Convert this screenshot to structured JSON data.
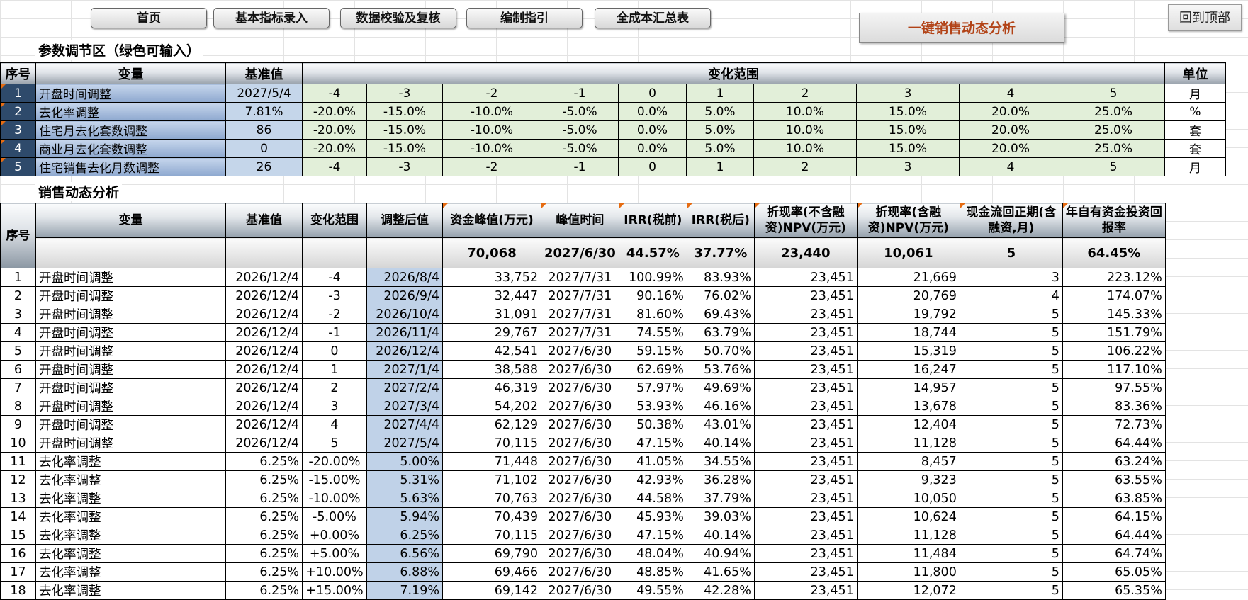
{
  "nav": {
    "buttons": [
      "首页",
      "基本指标录入",
      "数据校验及复核",
      "编制指引",
      "全成本汇总表"
    ],
    "analysis_button": "一键销售动态分析",
    "back_to_top": "回到顶部"
  },
  "param_section": {
    "title": "参数调节区（绿色可输入）",
    "headers": {
      "idx": "序号",
      "var": "变量",
      "base": "基准值",
      "range": "变化范围",
      "unit": "单位"
    },
    "rows": [
      {
        "idx": "1",
        "var": "开盘时间调整",
        "base": "2027/5/4",
        "range": [
          "-4",
          "-3",
          "-2",
          "-1",
          "0",
          "1",
          "2",
          "3",
          "4",
          "5"
        ],
        "unit": "月"
      },
      {
        "idx": "2",
        "var": "去化率调整",
        "base": "7.81%",
        "range": [
          "-20.0%",
          "-15.0%",
          "-10.0%",
          "-5.0%",
          "0.0%",
          "5.0%",
          "10.0%",
          "15.0%",
          "20.0%",
          "25.0%"
        ],
        "unit": "%"
      },
      {
        "idx": "3",
        "var": "住宅月去化套数调整",
        "base": "86",
        "range": [
          "-20.0%",
          "-15.0%",
          "-10.0%",
          "-5.0%",
          "0.0%",
          "5.0%",
          "10.0%",
          "15.0%",
          "20.0%",
          "25.0%"
        ],
        "unit": "套"
      },
      {
        "idx": "4",
        "var": "商业月去化套数调整",
        "base": "0",
        "range": [
          "-20.0%",
          "-15.0%",
          "-10.0%",
          "-5.0%",
          "0.0%",
          "5.0%",
          "10.0%",
          "15.0%",
          "20.0%",
          "25.0%"
        ],
        "unit": "套"
      },
      {
        "idx": "5",
        "var": "住宅销售去化月数调整",
        "base": "26",
        "range": [
          "-4",
          "-3",
          "-2",
          "-1",
          "0",
          "1",
          "2",
          "3",
          "4",
          "5"
        ],
        "unit": "月"
      }
    ]
  },
  "sales_section": {
    "title": "销售动态分析",
    "headers": [
      "序号",
      "变量",
      "基准值",
      "变化范围",
      "调整后值",
      "资金峰值(万元)",
      "峰值时间",
      "IRR(税前)",
      "IRR(税后)",
      "折现率(不含融资)NPV(万元)",
      "折现率(含融资)NPV(万元)",
      "现金流回正期(含融资,月)",
      "年自有资金投资回报率"
    ],
    "baseline": [
      "70,068",
      "2027/6/30",
      "44.57%",
      "37.77%",
      "23,440",
      "10,061",
      "5",
      "64.45%"
    ],
    "rows": [
      [
        "1",
        "开盘时间调整",
        "2026/12/4",
        "-4",
        "2026/8/4",
        "33,752",
        "2027/7/31",
        "100.99%",
        "83.93%",
        "23,451",
        "21,669",
        "3",
        "223.12%"
      ],
      [
        "2",
        "开盘时间调整",
        "2026/12/4",
        "-3",
        "2026/9/4",
        "32,447",
        "2027/7/31",
        "90.16%",
        "76.02%",
        "23,451",
        "20,769",
        "4",
        "174.07%"
      ],
      [
        "3",
        "开盘时间调整",
        "2026/12/4",
        "-2",
        "2026/10/4",
        "31,091",
        "2027/7/31",
        "81.60%",
        "69.43%",
        "23,451",
        "19,792",
        "5",
        "145.33%"
      ],
      [
        "4",
        "开盘时间调整",
        "2026/12/4",
        "-1",
        "2026/11/4",
        "29,767",
        "2027/7/31",
        "74.55%",
        "63.79%",
        "23,451",
        "18,744",
        "5",
        "151.79%"
      ],
      [
        "5",
        "开盘时间调整",
        "2026/12/4",
        "0",
        "2026/12/4",
        "42,541",
        "2027/6/30",
        "59.15%",
        "50.70%",
        "23,451",
        "15,319",
        "5",
        "106.22%"
      ],
      [
        "6",
        "开盘时间调整",
        "2026/12/4",
        "1",
        "2027/1/4",
        "38,588",
        "2027/6/30",
        "62.69%",
        "53.76%",
        "23,451",
        "16,247",
        "5",
        "117.10%"
      ],
      [
        "7",
        "开盘时间调整",
        "2026/12/4",
        "2",
        "2027/2/4",
        "46,319",
        "2027/6/30",
        "57.97%",
        "49.69%",
        "23,451",
        "14,957",
        "5",
        "97.55%"
      ],
      [
        "8",
        "开盘时间调整",
        "2026/12/4",
        "3",
        "2027/3/4",
        "54,202",
        "2027/6/30",
        "53.93%",
        "46.16%",
        "23,451",
        "13,678",
        "5",
        "83.36%"
      ],
      [
        "9",
        "开盘时间调整",
        "2026/12/4",
        "4",
        "2027/4/4",
        "62,129",
        "2027/6/30",
        "50.38%",
        "43.01%",
        "23,451",
        "12,404",
        "5",
        "72.73%"
      ],
      [
        "10",
        "开盘时间调整",
        "2026/12/4",
        "5",
        "2027/5/4",
        "70,115",
        "2027/6/30",
        "47.15%",
        "40.14%",
        "23,451",
        "11,128",
        "5",
        "64.44%"
      ],
      [
        "11",
        "去化率调整",
        "6.25%",
        "-20.00%",
        "5.00%",
        "71,448",
        "2027/6/30",
        "41.05%",
        "34.55%",
        "23,451",
        "8,457",
        "5",
        "63.24%"
      ],
      [
        "12",
        "去化率调整",
        "6.25%",
        "-15.00%",
        "5.31%",
        "71,102",
        "2027/6/30",
        "42.93%",
        "36.28%",
        "23,451",
        "9,323",
        "5",
        "63.55%"
      ],
      [
        "13",
        "去化率调整",
        "6.25%",
        "-10.00%",
        "5.63%",
        "70,763",
        "2027/6/30",
        "44.58%",
        "37.79%",
        "23,451",
        "10,050",
        "5",
        "63.85%"
      ],
      [
        "14",
        "去化率调整",
        "6.25%",
        "-5.00%",
        "5.94%",
        "70,439",
        "2027/6/30",
        "45.93%",
        "39.03%",
        "23,451",
        "10,624",
        "5",
        "64.15%"
      ],
      [
        "15",
        "去化率调整",
        "6.25%",
        "+0.00%",
        "6.25%",
        "70,115",
        "2027/6/30",
        "47.15%",
        "40.14%",
        "23,451",
        "11,128",
        "5",
        "64.44%"
      ],
      [
        "16",
        "去化率调整",
        "6.25%",
        "+5.00%",
        "6.56%",
        "69,790",
        "2027/6/30",
        "48.04%",
        "40.94%",
        "23,451",
        "11,484",
        "5",
        "64.74%"
      ],
      [
        "17",
        "去化率调整",
        "6.25%",
        "+10.00%",
        "6.88%",
        "69,466",
        "2027/6/30",
        "48.85%",
        "41.65%",
        "23,451",
        "11,800",
        "5",
        "65.05%"
      ],
      [
        "18",
        "去化率调整",
        "6.25%",
        "+15.00%",
        "7.19%",
        "69,142",
        "2027/6/30",
        "49.55%",
        "42.28%",
        "23,451",
        "12,072",
        "5",
        "65.35%"
      ]
    ]
  }
}
